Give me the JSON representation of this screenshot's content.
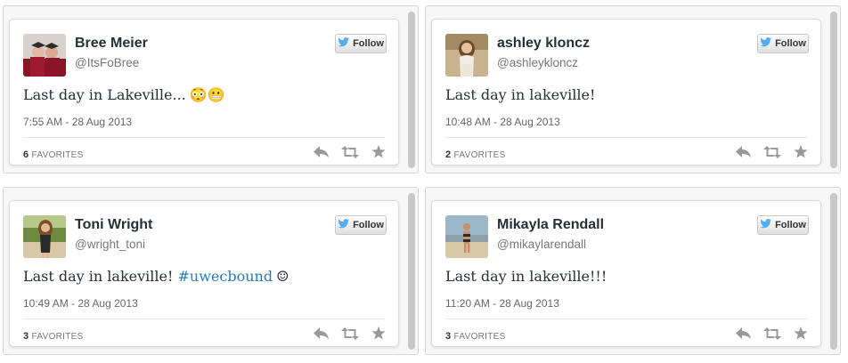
{
  "follow_label": "Follow",
  "favorites_label": "FAVORITES",
  "colors": {
    "hashtag": "#2b7bb9",
    "text": "#292f33",
    "muted": "#777777",
    "twitter_blue": "#55acee"
  },
  "icons": [
    "twitter-bird-icon",
    "reply-icon",
    "retweet-icon",
    "star-icon"
  ],
  "tweets": [
    {
      "name": "Bree Meier",
      "handle": "@ItsFoBree",
      "text": "Last day in Lakeville...",
      "hashtag": "",
      "extra": "😳😬",
      "timestamp": "7:55 AM - 28 Aug 2013",
      "favorites": "6"
    },
    {
      "name": "ashley kloncz",
      "handle": "@ashleykloncz",
      "text": "Last day in lakeville!",
      "hashtag": "",
      "extra": "",
      "timestamp": "10:48 AM - 28 Aug 2013",
      "favorites": "2"
    },
    {
      "name": "Toni Wright",
      "handle": "@wright_toni",
      "text": "Last day in lakeville!",
      "hashtag": "#uwecbound",
      "extra": "☺",
      "timestamp": "10:49 AM - 28 Aug 2013",
      "favorites": "3"
    },
    {
      "name": "Mikayla Rendall",
      "handle": "@mikaylarendall",
      "text": "Last day in lakeville!!!",
      "hashtag": "",
      "extra": "",
      "timestamp": "11:20 AM - 28 Aug 2013",
      "favorites": "3"
    }
  ]
}
